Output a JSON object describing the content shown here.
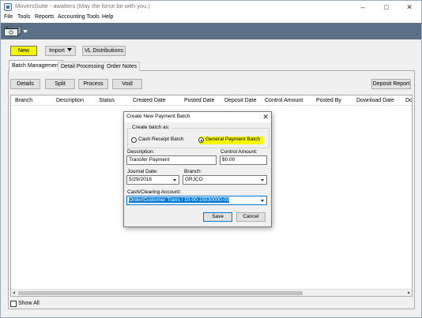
{
  "window": {
    "title": "MoversSuite - awalters (May the force be with you.)",
    "minimize_glyph": "–",
    "maximize_glyph": "□",
    "close_glyph": "✕"
  },
  "menu": [
    "File",
    "Tools",
    "Reports",
    "Accounting Tools",
    "Help"
  ],
  "toolbar": {
    "money_icon": "money-stack-icon",
    "new_label": "New",
    "import_label": "Import",
    "vl_distributions_label": "VL Distributions"
  },
  "tabs": [
    {
      "label": "Batch Management",
      "active": true
    },
    {
      "label": "Detail Processing",
      "active": false
    },
    {
      "label": "Order Notes",
      "active": false
    }
  ],
  "batch_actions": {
    "details": "Details",
    "split": "Split",
    "process": "Process",
    "void": "Void",
    "deposit_report": "Deposit Report"
  },
  "grid": {
    "columns": [
      "Branch",
      "Description",
      "Status",
      "Created Date",
      "Posted Date",
      "Deposit Date",
      "Control Amount",
      "Posted By",
      "Download Date",
      "Do"
    ],
    "rows": []
  },
  "show_all_label": "Show All",
  "dialog": {
    "title": "Create New Payment Batch",
    "close_glyph": "✕",
    "create_as_label": "Create batch as:",
    "radio_cash": "Cash Receipt Batch",
    "radio_general": "General Payment Batch",
    "selected": "General Payment Batch",
    "description_label": "Description:",
    "description_value": "Transfer Payment",
    "control_amount_label": "Control Amount:",
    "control_amount_value": "$0.00",
    "journal_date_label": "Journal Date:",
    "journal_date_value": "5/29/2018",
    "branch_label": "Branch:",
    "branch_value": "GRJCO",
    "account_label": "Cash/Clearing Account:",
    "account_value": "Order/Customer Trans / 10-00-15530000-00",
    "save_label": "Save",
    "cancel_label": "Cancel"
  },
  "colors": {
    "toolbar_strip": "#5b6f87",
    "highlight_yellow": "#f5f500",
    "selection_blue": "#0078d7"
  }
}
